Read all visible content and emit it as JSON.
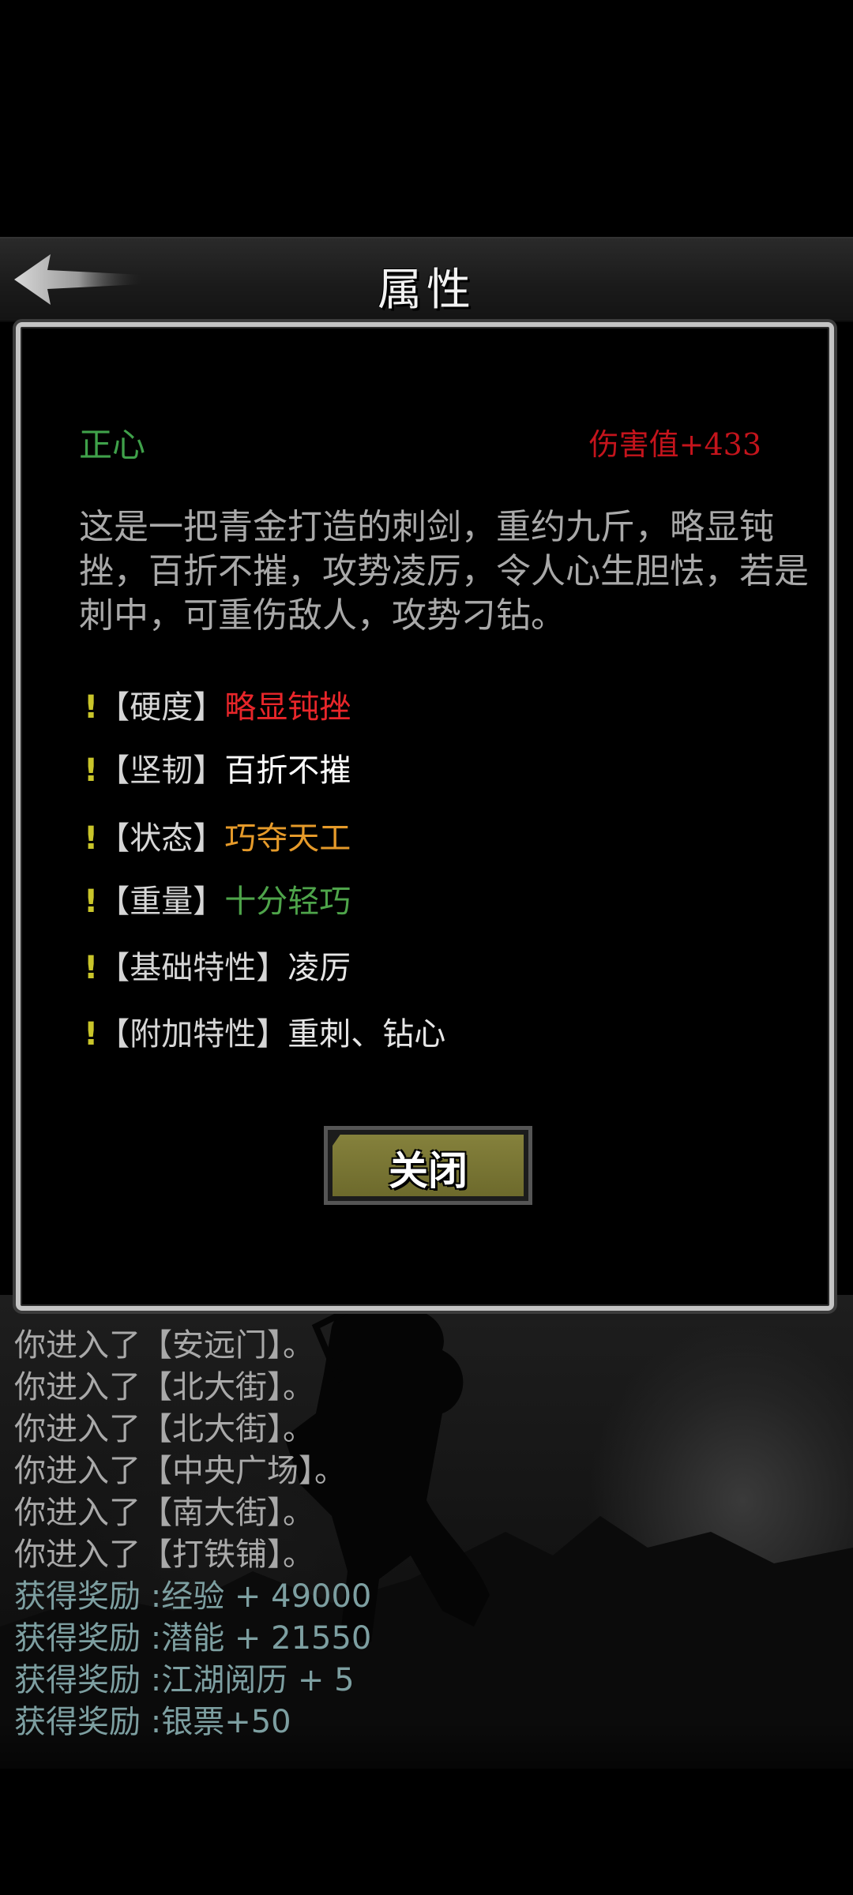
{
  "header": {
    "title": "属性"
  },
  "item": {
    "name": "正心",
    "damage": "伤害值+433",
    "description": "这是一把青金打造的刺剑，重约九斤，略显钝挫，百折不摧，攻势凌厉，令人心生胆怯，若是刺中，可重伤敌人，攻势刁钻。"
  },
  "attributes": [
    {
      "mark": "!",
      "label": "【硬度】",
      "value": "略显钝挫",
      "color": "#e8262a"
    },
    {
      "mark": "!",
      "label": "【坚韧】",
      "value": "百折不摧",
      "color": "#ffffff"
    },
    {
      "mark": "!",
      "label": "【状态】",
      "value": "巧夺天工",
      "color": "#e59a2a"
    },
    {
      "mark": "!",
      "label": "【重量】",
      "value": "十分轻巧",
      "color": "#4ea44a"
    },
    {
      "mark": "!",
      "label": "【基础特性】",
      "value": "凌厉",
      "color": "#e6e6e6"
    },
    {
      "mark": "!",
      "label": "【附加特性】",
      "value": "重刺、钻心",
      "color": "#e6e6e6"
    }
  ],
  "close_button": {
    "label": "关闭"
  },
  "log": [
    {
      "text": "你进入了【安远门】。",
      "type": "sys"
    },
    {
      "text": "你进入了【北大街】。",
      "type": "sys"
    },
    {
      "text": "你进入了【北大街】。",
      "type": "sys"
    },
    {
      "text": "你进入了【中央广场】。",
      "type": "sys"
    },
    {
      "text": "你进入了【南大街】。",
      "type": "sys"
    },
    {
      "text": "你进入了【打铁铺】。",
      "type": "sys"
    },
    {
      "text": "获得奖励 :经验 + 49000",
      "type": "reward"
    },
    {
      "text": "获得奖励 :潜能 + 21550",
      "type": "reward"
    },
    {
      "text": "获得奖励 :江湖阅历 + 5",
      "type": "reward"
    },
    {
      "text": "获得奖励 :银票+50",
      "type": "reward"
    }
  ]
}
